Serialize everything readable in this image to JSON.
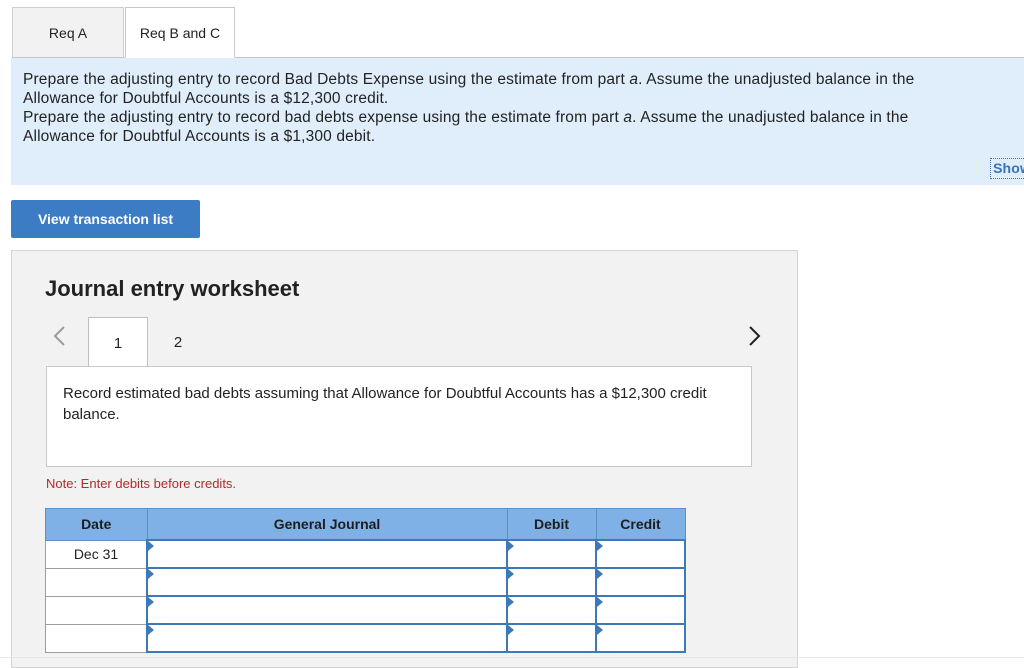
{
  "tabs": [
    {
      "label": "Req A"
    },
    {
      "label": "Req B and C"
    }
  ],
  "instructions": {
    "line1_pre": "Prepare the adjusting entry to record Bad Debts Expense using the estimate from part ",
    "line1_em": "a",
    "line1_post": ". Assume the unadjusted balance in the",
    "line2": "Allowance for Doubtful Accounts is a $12,300 credit.",
    "line3_pre": "Prepare the adjusting entry to record bad debts expense using the estimate from part ",
    "line3_em": "a",
    "line3_post": ". Assume the unadjusted balance in the",
    "line4": "Allowance for Doubtful Accounts is a $1,300 debit.",
    "show_link": "Show"
  },
  "view_button": "View transaction list",
  "worksheet": {
    "title": "Journal entry worksheet",
    "pages": [
      "1",
      "2"
    ],
    "description": "Record estimated bad debts assuming that Allowance for Doubtful Accounts has a $12,300 credit balance.",
    "note": "Note: Enter debits before credits.",
    "columns": [
      "Date",
      "General Journal",
      "Debit",
      "Credit"
    ],
    "rows": [
      {
        "date": "Dec 31",
        "account": "",
        "debit": "",
        "credit": ""
      },
      {
        "date": "",
        "account": "",
        "debit": "",
        "credit": ""
      },
      {
        "date": "",
        "account": "",
        "debit": "",
        "credit": ""
      },
      {
        "date": "",
        "account": "",
        "debit": "",
        "credit": ""
      }
    ]
  }
}
